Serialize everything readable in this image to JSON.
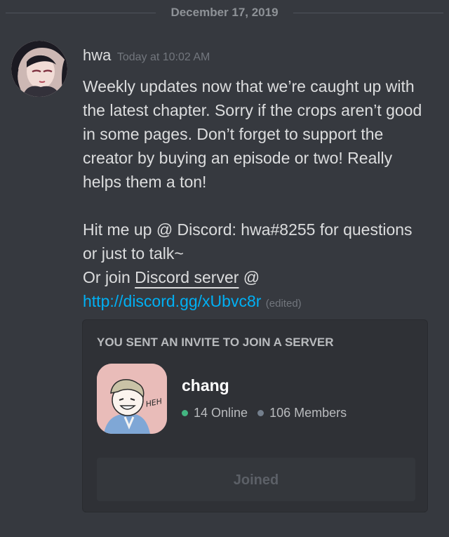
{
  "date_divider": "December 17, 2019",
  "message": {
    "author": "hwa",
    "timestamp": "Today at 10:02 AM",
    "paragraph1": "Weekly updates now that we’re caught up with the latest chapter. Sorry if the crops aren’t good in some pages. Don’t forget to support the creator by buying an episode or two! Really helps them a ton!",
    "line_contact": "Hit me up @ Discord: hwa#8255 for questions or just to talk~",
    "join_prefix": "Or join ",
    "join_server_text": "Discord server",
    "join_at": " @ ",
    "link_text": "http://discord.gg/xUbvc8r",
    "edited_label": "(edited)"
  },
  "invite": {
    "title": "YOU SENT AN INVITE TO JOIN A SERVER",
    "server_name": "chang",
    "online": "14 Online",
    "members": "106 Members",
    "button_label": "Joined",
    "icon_caption": "HEH"
  },
  "colors": {
    "background": "#36393f",
    "card": "#2f3136",
    "link": "#00b0f4",
    "online": "#43b581"
  }
}
